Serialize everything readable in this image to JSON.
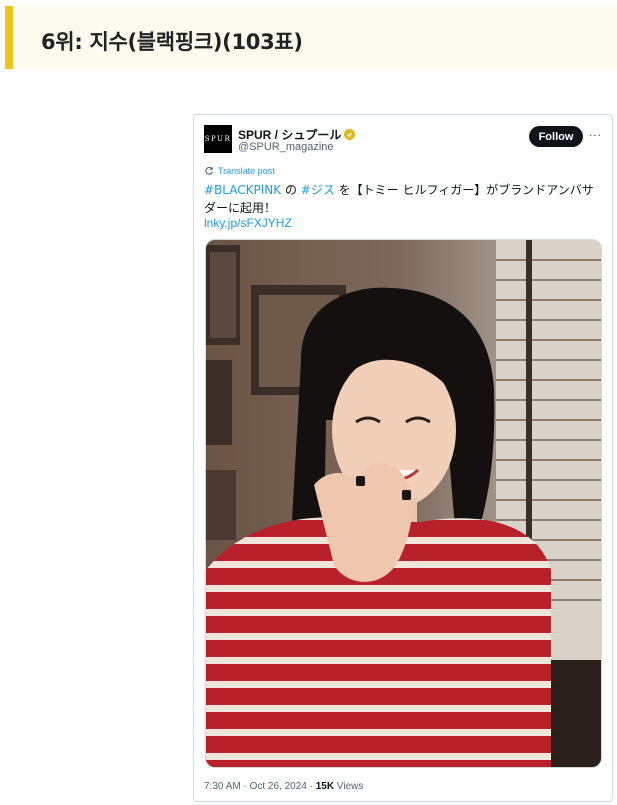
{
  "header": {
    "title": "6위: 지수(블랙핑크)(103표)"
  },
  "tweet": {
    "avatar_text": "SPUR",
    "display_name": "SPUR / シュプール",
    "handle": "@SPUR_magazine",
    "follow_label": "Follow",
    "more_label": "···",
    "translate_label": "Translate post",
    "text": {
      "hashtag1": "#BLACKPINK",
      "part1": " の ",
      "hashtag2": "#ジス",
      "part2": " を【トミー ヒルフィガー】がブランドアンバサダーに起用！"
    },
    "link": "lnky.jp/sFXJYHZ",
    "media_icon": "photo-of-smiling-woman-in-red-striped-sweater",
    "time": "7:30 AM",
    "date": "Oct 26, 2024",
    "separator": " · ",
    "views_count": "15K",
    "views_label": " Views"
  },
  "colors": {
    "accent_bar": "#f0c419",
    "link": "#1d9bf0",
    "verified": "#e2b719"
  }
}
